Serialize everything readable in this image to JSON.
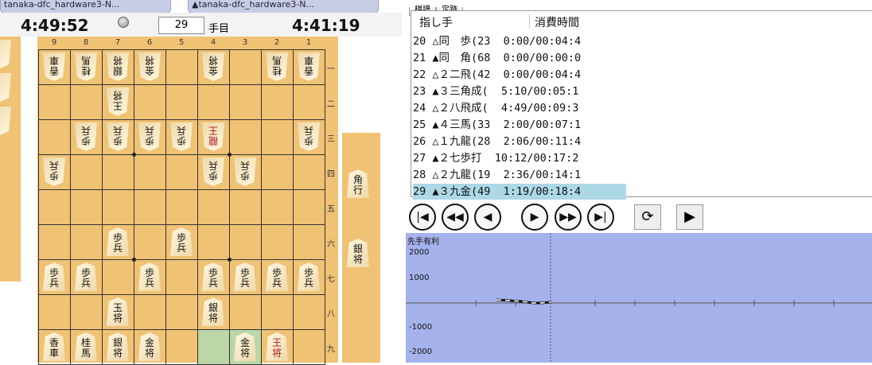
{
  "players": {
    "sente_tab": "tanaka-dfc_hardware3-N...",
    "gote_tab": "▲tanaka-dfc_hardware3-N..."
  },
  "clock": {
    "left_time": "4:49:52",
    "right_time": "4:41:19",
    "move_number": "29",
    "move_suffix": "手目"
  },
  "board": {
    "col_labels": [
      "9",
      "8",
      "7",
      "6",
      "5",
      "4",
      "3",
      "2",
      "1"
    ],
    "row_labels": [
      "一",
      "二",
      "三",
      "四",
      "五",
      "六",
      "七",
      "八",
      "九"
    ],
    "pieces": [
      {
        "r": 0,
        "c": 0,
        "t1": "香",
        "t2": "車",
        "side": "gote"
      },
      {
        "r": 0,
        "c": 1,
        "t1": "桂",
        "t2": "馬",
        "side": "gote"
      },
      {
        "r": 0,
        "c": 2,
        "t1": "銀",
        "t2": "将",
        "side": "gote"
      },
      {
        "r": 0,
        "c": 3,
        "t1": "金",
        "t2": "将",
        "side": "gote"
      },
      {
        "r": 0,
        "c": 5,
        "t1": "金",
        "t2": "将",
        "side": "gote"
      },
      {
        "r": 0,
        "c": 7,
        "t1": "桂",
        "t2": "馬",
        "side": "gote"
      },
      {
        "r": 0,
        "c": 8,
        "t1": "香",
        "t2": "車",
        "side": "gote"
      },
      {
        "r": 1,
        "c": 2,
        "t1": "王",
        "t2": "将",
        "side": "gote"
      },
      {
        "r": 2,
        "c": 1,
        "t1": "歩",
        "t2": "兵",
        "side": "gote"
      },
      {
        "r": 2,
        "c": 2,
        "t1": "歩",
        "t2": "兵",
        "side": "gote"
      },
      {
        "r": 2,
        "c": 3,
        "t1": "歩",
        "t2": "兵",
        "side": "gote"
      },
      {
        "r": 2,
        "c": 4,
        "t1": "歩",
        "t2": "兵",
        "side": "gote"
      },
      {
        "r": 2,
        "c": 5,
        "t1": "龍",
        "t2": "王",
        "side": "gote",
        "red": true
      },
      {
        "r": 2,
        "c": 8,
        "t1": "歩",
        "t2": "兵",
        "side": "gote"
      },
      {
        "r": 3,
        "c": 0,
        "t1": "歩",
        "t2": "兵",
        "side": "gote"
      },
      {
        "r": 3,
        "c": 5,
        "t1": "歩",
        "t2": "兵",
        "side": "gote"
      },
      {
        "r": 3,
        "c": 6,
        "t1": "歩",
        "t2": "兵",
        "side": "gote"
      },
      {
        "r": 5,
        "c": 2,
        "t1": "歩",
        "t2": "兵",
        "side": "sente"
      },
      {
        "r": 5,
        "c": 4,
        "t1": "歩",
        "t2": "兵",
        "side": "sente"
      },
      {
        "r": 6,
        "c": 0,
        "t1": "歩",
        "t2": "兵",
        "side": "sente"
      },
      {
        "r": 6,
        "c": 1,
        "t1": "歩",
        "t2": "兵",
        "side": "sente"
      },
      {
        "r": 6,
        "c": 3,
        "t1": "歩",
        "t2": "兵",
        "side": "sente"
      },
      {
        "r": 6,
        "c": 5,
        "t1": "歩",
        "t2": "兵",
        "side": "sente"
      },
      {
        "r": 6,
        "c": 6,
        "t1": "歩",
        "t2": "兵",
        "side": "sente"
      },
      {
        "r": 6,
        "c": 7,
        "t1": "歩",
        "t2": "兵",
        "side": "sente"
      },
      {
        "r": 6,
        "c": 8,
        "t1": "歩",
        "t2": "兵",
        "side": "sente"
      },
      {
        "r": 7,
        "c": 2,
        "t1": "玉",
        "t2": "将",
        "side": "sente"
      },
      {
        "r": 7,
        "c": 5,
        "t1": "銀",
        "t2": "将",
        "side": "sente"
      },
      {
        "r": 8,
        "c": 0,
        "t1": "香",
        "t2": "車",
        "side": "sente"
      },
      {
        "r": 8,
        "c": 1,
        "t1": "桂",
        "t2": "馬",
        "side": "sente"
      },
      {
        "r": 8,
        "c": 2,
        "t1": "銀",
        "t2": "将",
        "side": "sente"
      },
      {
        "r": 8,
        "c": 3,
        "t1": "金",
        "t2": "将",
        "side": "sente"
      },
      {
        "r": 8,
        "c": 6,
        "t1": "金",
        "t2": "将",
        "side": "sente"
      },
      {
        "r": 8,
        "c": 7,
        "t1": "王",
        "t2": "将",
        "side": "sente",
        "red": true
      }
    ],
    "highlight": [
      {
        "r": 8,
        "c": 5
      },
      {
        "r": 8,
        "c": 6
      }
    ]
  },
  "hand_right": [
    {
      "t1": "角",
      "t2": "行"
    },
    {
      "t1": "銀",
      "t2": "将"
    }
  ],
  "moves_panel": {
    "tabs": [
      "棋譜",
      "定跡"
    ],
    "header_move": "指し手",
    "header_time": "消費時間",
    "rows": [
      "20 △同　歩(23  0:00/00:04:4",
      "21 ▲同　角(68  0:00/00:00:0",
      "22 △２二飛(42  0:00/00:04:4",
      "23 ▲３三角成(  5:10/00:05:1",
      "24 △２八飛成(  4:49/00:09:3",
      "25 ▲４三馬(33  2:00/00:07:1",
      "26 △１九龍(28  2:06/00:11:4",
      "27 ▲２七歩打  10:12/00:17:2",
      "28 △２九龍(19  2:36/00:14:1",
      "29 ▲３九金(49  1:19/00:18:4"
    ],
    "selected_index": 9
  },
  "graph": {
    "title": "先手有利",
    "y_ticks": [
      "2000",
      "1000",
      "0",
      "-1000",
      "-2000"
    ]
  },
  "colors": {
    "board": "#f0c274",
    "graph_bg": "#a6b2ec",
    "selection": "#add8e6"
  }
}
